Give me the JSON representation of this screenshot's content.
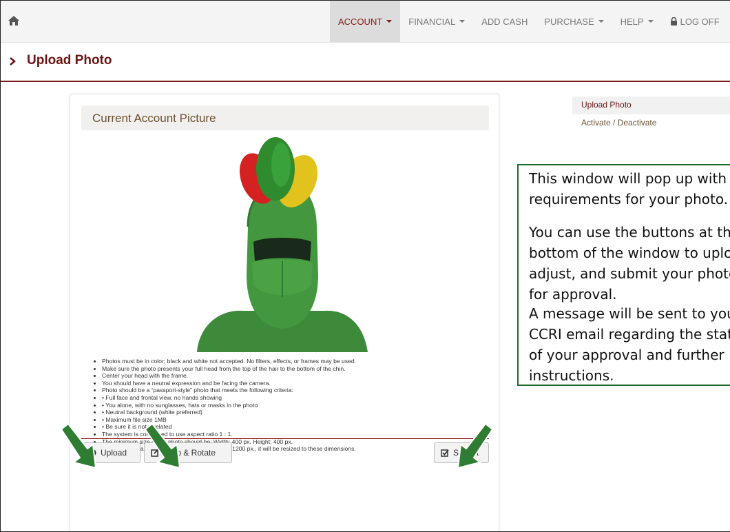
{
  "navbar": {
    "home_icon": "home-icon",
    "items": [
      {
        "label": "ACCOUNT",
        "dropdown": true,
        "active": true
      },
      {
        "label": "FINANCIAL",
        "dropdown": true
      },
      {
        "label": "ADD CASH",
        "dropdown": false
      },
      {
        "label": "PURCHASE",
        "dropdown": true
      },
      {
        "label": "HELP",
        "dropdown": true
      }
    ],
    "logoff_label": "LOG OFF"
  },
  "page": {
    "title": "Upload Photo"
  },
  "panel": {
    "title": "Current Account Picture",
    "requirements": [
      "Photos must be in color; black and white not accepted. No filters, effects, or frames may be used.",
      "Make sure the photo presents your full head from the top of the hair to the bottom of the chin.",
      "Center your head with the frame.",
      "You should have a neutral expression and be facing the camera.",
      "Photo should be a “passport-style” photo that meets the following criteria:",
      "• Full face and frontal view, no hands showing",
      "• You alone, with no sunglasses, hats or masks in the photo",
      "• Neutral background (white preferred)",
      "• Maximum file size 1MB",
      "• Be sure it is not pixelated",
      "The system is configured to use aspect ratio 1 : 1.",
      "The minimum size of the photo should be: Width: 400 px. Height: 400 px.",
      "If the photo is larger than: Width 1200 px. Height: 1200 px., it will be resized to these dimensions."
    ],
    "buttons": {
      "upload": "Upload",
      "crop": "Crop & Rotate",
      "submit": "Submit"
    }
  },
  "side_nav": {
    "items": [
      "Upload Photo",
      "Activate / Deactivate"
    ]
  },
  "callout": {
    "paragraphs": [
      "This window will pop up with requirements for your photo.",
      "You can use the buttons at the bottom of the window to upload, adjust, and submit your photo for approval.",
      "A message will be sent to your CCRI email regarding the status of your approval and further instructions."
    ]
  },
  "colors": {
    "accent": "#6b1414",
    "callout_border": "#1f6b2e",
    "arrow": "#2e7d32"
  }
}
